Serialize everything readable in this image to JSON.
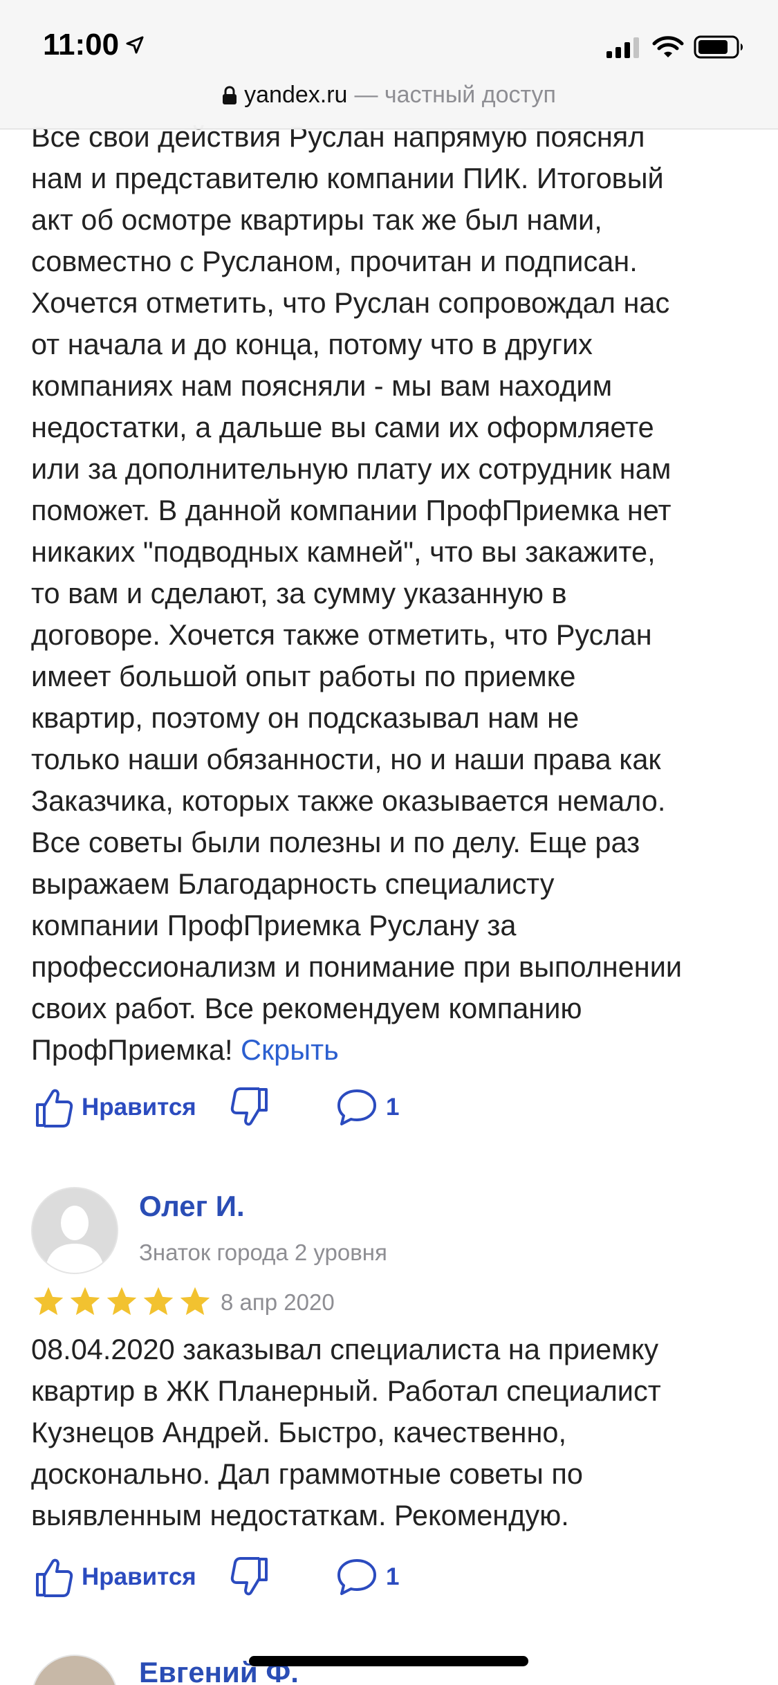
{
  "status_bar": {
    "time": "11:00"
  },
  "browser": {
    "domain": "yandex.ru",
    "suffix": "— частный доступ"
  },
  "review1": {
    "lines": [
      "Все свои действия Руслан напрямую пояснял",
      "нам и представителю компании ПИК. Итоговый",
      "акт об осмотре квартиры так же был нами,",
      "совместно с Русланом, прочитан и подписан.",
      "Хочется отметить, что Руслан сопровождал нас",
      "от начала и до конца, потому что в других",
      "компаниях нам поясняли - мы вам находим",
      "недостатки, а дальше вы сами их оформляете",
      "или за дополнительную плату их сотрудник нам",
      "поможет. В данной компании ПрофПриемка нет",
      "никаких \"подводных камней\", что вы закажите,",
      "то вам и сделают, за сумму указанную в",
      "договоре. Хочется также отметить, что Руслан",
      "имеет большой опыт работы по приемке",
      "квартир, поэтому он подсказывал нам не",
      "только наши обязанности, но и наши права как",
      "Заказчика, которых также оказывается немало.",
      "Все советы были полезны и по делу. Еще раз",
      "выражаем Благодарность специалисту",
      "компании ПрофПриемка Руслану за",
      "профессионализм и понимание при выполнении",
      "своих работ. Все рекомендуем компанию"
    ],
    "last_line": "ПрофПриемка!",
    "hide_link": "Скрыть",
    "like_label": "Нравится",
    "comment_count": "1"
  },
  "review2": {
    "author": "Олег И.",
    "level": "Знаток города 2 уровня",
    "rating": 5,
    "date": "8 апр 2020",
    "lines": [
      "08.04.2020 заказывал специалиста на приемку",
      "квартир в ЖК Планерный. Работал специалист",
      "Кузнецов Андрей. Быстро, качественно,",
      "досконально. Дал граммотные советы по",
      "выявленным недостаткам. Рекомендую."
    ],
    "like_label": "Нравится",
    "comment_count": "1"
  },
  "review3": {
    "author": "Евгений Ф."
  },
  "colors": {
    "link": "#2b5fd0",
    "action": "#2b4bbf",
    "star": "#f2c230",
    "muted": "#8e8e93"
  }
}
